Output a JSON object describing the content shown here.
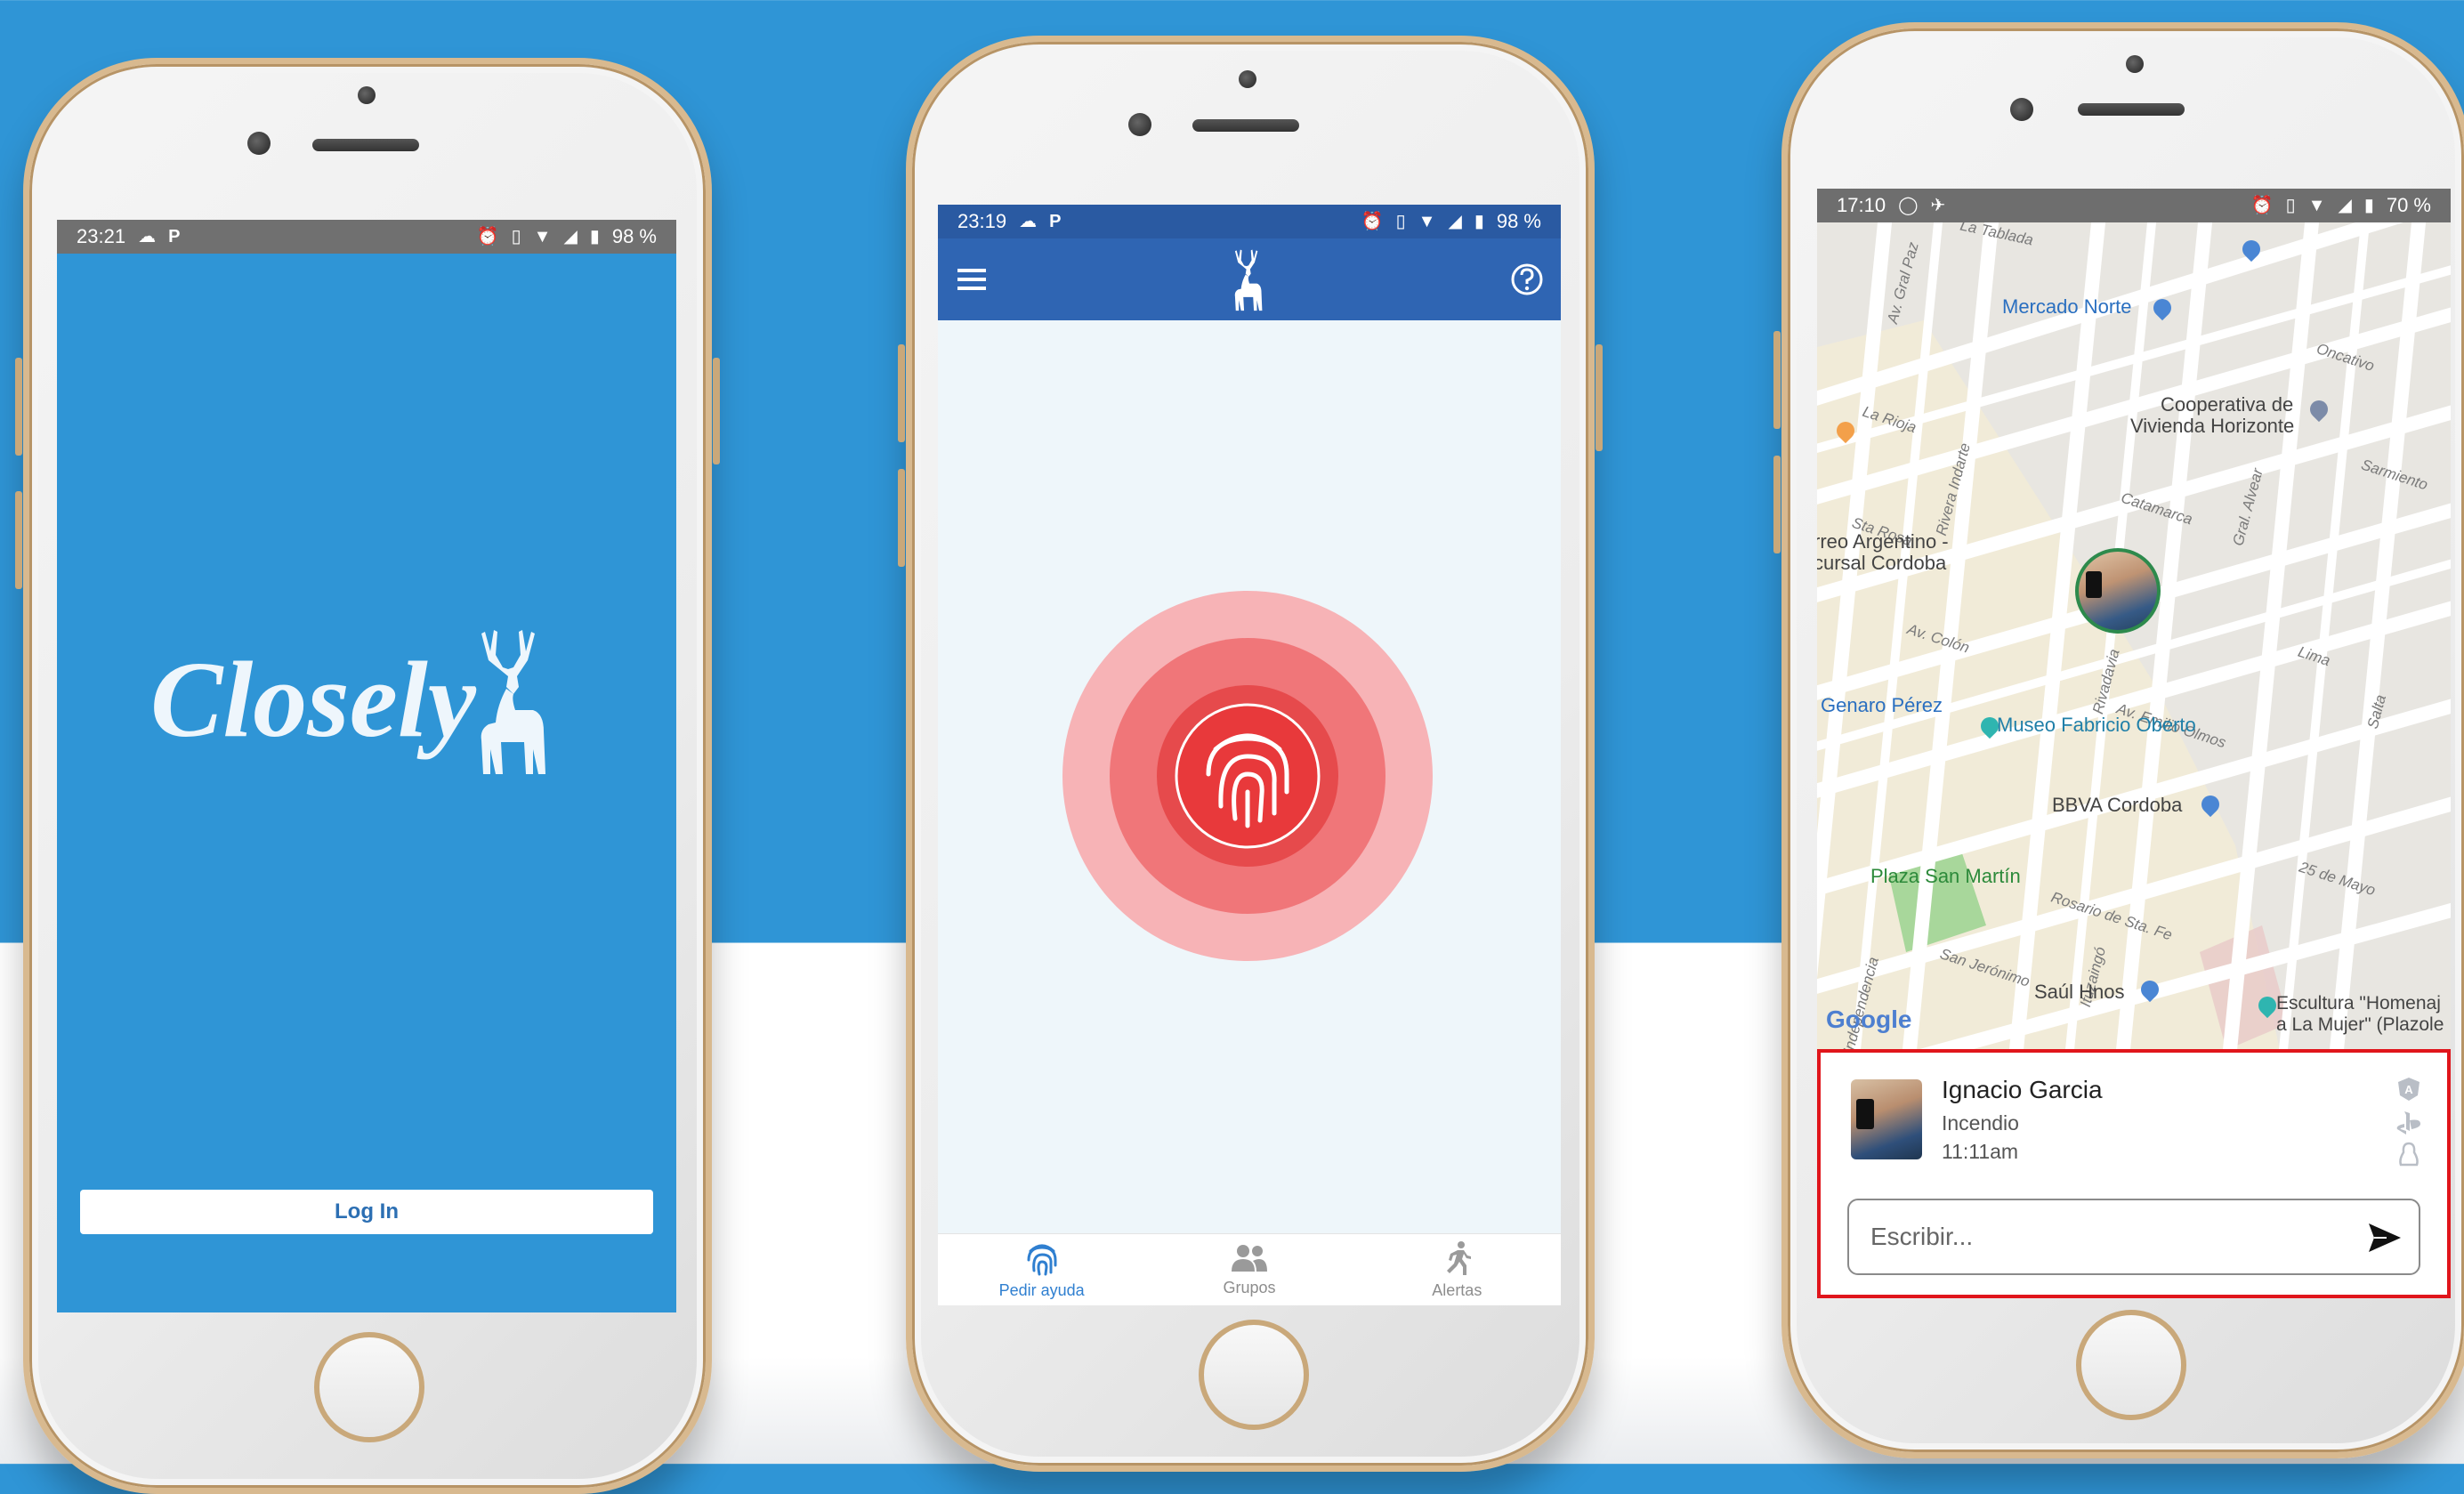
{
  "phone_login": {
    "status": {
      "time": "23:21",
      "battery": "98 %"
    },
    "logo_text": "Closely",
    "login_button": "Log In"
  },
  "phone_help": {
    "status": {
      "time": "23:19",
      "battery": "98 %"
    },
    "nav": [
      {
        "label": "Pedir ayuda",
        "icon": "fingerprint-icon",
        "active": true
      },
      {
        "label": "Grupos",
        "icon": "group-icon",
        "active": false
      },
      {
        "label": "Alertas",
        "icon": "running-person-icon",
        "active": false
      }
    ],
    "colors": {
      "appbar": "#2f65b3",
      "accent": "#e8393b",
      "active_nav": "#2f7fd0"
    }
  },
  "phone_map": {
    "status": {
      "time": "17:10",
      "battery": "70 %"
    },
    "map": {
      "places": {
        "mercado": "Mercado Norte",
        "cooperativa_1": "Cooperativa de",
        "cooperativa_2": "Vivienda Horizonte",
        "correo_1": "rreo Argentino -",
        "correo_2": "cursal Cordoba",
        "genaro": "Genaro Pérez",
        "museo": "Museo Fabricio Oberto",
        "bbva": "BBVA Cordoba",
        "plaza": "Plaza San Martín",
        "saul": "Saúl Hnos",
        "escultura_1": "Escultura \"Homenaj",
        "escultura_2": "a La Mujer\" (Plazole",
        "google": "Google"
      },
      "streets": {
        "tablada": "La Tablada",
        "gral_paz": "Av. Gral Paz",
        "oncativo": "Oncativo",
        "la_rioja": "La Rioja",
        "rivera": "Rivera Indarte",
        "sarmiento": "Sarmiento",
        "catamarca": "Catamarca",
        "sta_rosa": "Sta Rosa",
        "gral_alvear": "Gral. Alvear",
        "av_colon": "Av. Colón",
        "rivadavia": "Rivadavia",
        "lima": "Lima",
        "emilio": "Av. Emilio Olmos",
        "salta": "Salta",
        "mayo": "25 de Mayo",
        "rosario": "Rosario de Sta. Fe",
        "san_jeronimo": "San Jerónimo",
        "ituzaingo": "Ituzaingó",
        "independencia": "Independencia"
      }
    },
    "alert": {
      "name": "Ignacio Garcia",
      "type": "Incendio",
      "time": "11:11am"
    },
    "message": {
      "placeholder": "Escribir..."
    },
    "colors": {
      "alert_border": "#e0151b"
    }
  }
}
